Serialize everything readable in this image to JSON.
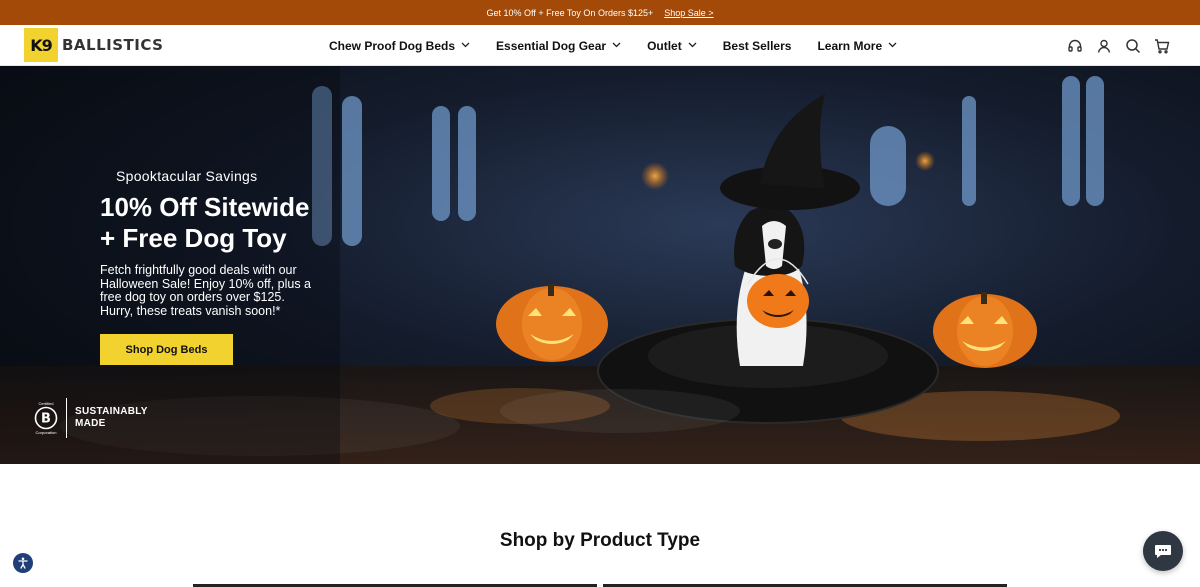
{
  "announcement": {
    "text": "Get 10% Off + Free Toy On Orders $125+",
    "link_label": "Shop Sale >"
  },
  "header": {
    "logo_badge": "K9",
    "logo_text": "BALLISTICS",
    "nav": [
      {
        "label": "Chew Proof Dog Beds",
        "has_dropdown": true
      },
      {
        "label": "Essential Dog Gear",
        "has_dropdown": true
      },
      {
        "label": "Outlet",
        "has_dropdown": true
      },
      {
        "label": "Best Sellers",
        "has_dropdown": false
      },
      {
        "label": "Learn More",
        "has_dropdown": true
      }
    ],
    "icons": [
      "support-headset-icon",
      "account-icon",
      "search-icon",
      "cart-icon"
    ]
  },
  "hero": {
    "eyebrow": "Spooktacular Savings",
    "headline_line1": "10% Off Sitewide",
    "headline_line2": "+ Free Dog Toy",
    "body": "Fetch frightfully good deals with our Halloween Sale! Enjoy 10% off, plus a free dog toy on orders over $125. Hurry, these treats vanish soon!*",
    "cta_label": "Shop Dog Beds",
    "badge": {
      "certified": "Certified",
      "letter": "B",
      "corporation": "Corporation",
      "text_line1": "SUSTAINABLY",
      "text_line2": "MADE"
    }
  },
  "section": {
    "title": "Shop by Product Type"
  },
  "colors": {
    "announcement_bg": "#a34a08",
    "brand_yellow": "#f2d22e",
    "accessibility_blue": "#1f3f78",
    "chat_bg": "#2f3742"
  }
}
